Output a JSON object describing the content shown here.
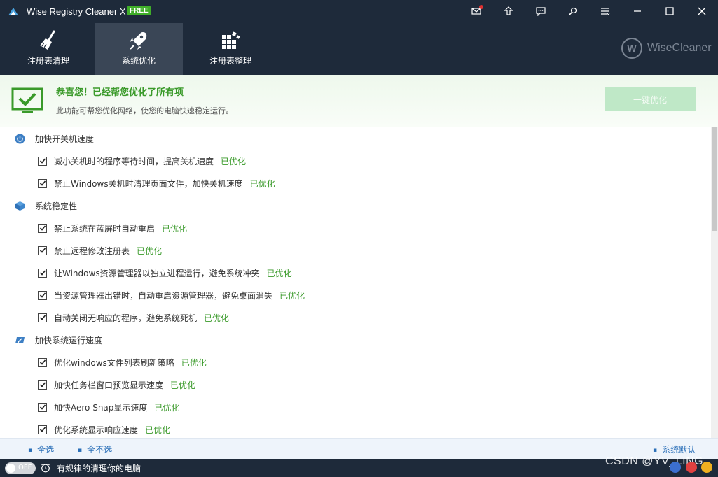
{
  "window": {
    "title": "Wise Registry Cleaner X",
    "badge": "FREE"
  },
  "titlebar_icons": [
    "mail-icon",
    "upgrade-icon",
    "feedback-icon",
    "tools-icon",
    "menu-icon",
    "minimize-icon",
    "maximize-icon",
    "close-icon"
  ],
  "tabs": [
    {
      "label": "注册表清理",
      "icon": "broom-icon"
    },
    {
      "label": "系统优化",
      "icon": "rocket-icon",
      "active": true
    },
    {
      "label": "注册表整理",
      "icon": "blocks-icon"
    }
  ],
  "brand": {
    "name": "WiseCleaner"
  },
  "banner": {
    "title": "恭喜您！已经帮您优化了所有项",
    "description": "此功能可帮您优化网络，使您的电脑快速稳定运行。",
    "button": "一键优化"
  },
  "categories": [
    {
      "label": "加快开关机速度",
      "icon": "power-icon",
      "items": [
        {
          "label": "减小关机时的程序等待时间，提高关机速度",
          "status": "已优化",
          "checked": true
        },
        {
          "label": "禁止Windows关机时清理页面文件，加快关机速度",
          "status": "已优化",
          "checked": true
        }
      ]
    },
    {
      "label": "系统稳定性",
      "icon": "cube-icon",
      "items": [
        {
          "label": "禁止系统在蓝屏时自动重启",
          "status": "已优化",
          "checked": true
        },
        {
          "label": "禁止远程修改注册表",
          "status": "已优化",
          "checked": true
        },
        {
          "label": "让Windows资源管理器以独立进程运行，避免系统冲突",
          "status": "已优化",
          "checked": true
        },
        {
          "label": "当资源管理器出错时，自动重启资源管理器，避免桌面消失",
          "status": "已优化",
          "checked": true
        },
        {
          "label": "自动关闭无响应的程序，避免系统死机",
          "status": "已优化",
          "checked": true
        }
      ]
    },
    {
      "label": "加快系统运行速度",
      "icon": "speed-icon",
      "items": [
        {
          "label": "优化windows文件列表刷新策略",
          "status": "已优化",
          "checked": true
        },
        {
          "label": "加快任务栏窗口预览显示速度",
          "status": "已优化",
          "checked": true
        },
        {
          "label": "加快Aero Snap显示速度",
          "status": "已优化",
          "checked": true
        },
        {
          "label": "优化系统显示响应速度",
          "status": "已优化",
          "checked": true
        }
      ]
    }
  ],
  "footer": {
    "select_all": "全选",
    "select_none": "全不选",
    "restore_default": "系统默认"
  },
  "statusbar": {
    "toggle_text": "OFF",
    "schedule_text": "有规律的清理你的电脑",
    "watermark": "CSDN @YV_LING"
  },
  "colors": {
    "header_bg": "#1e2a3a",
    "active_tab_bg": "#3a4656",
    "accent_green": "#3a9a2a",
    "link_blue": "#2a6fb8",
    "button_disabled": "#bfe8c7"
  }
}
